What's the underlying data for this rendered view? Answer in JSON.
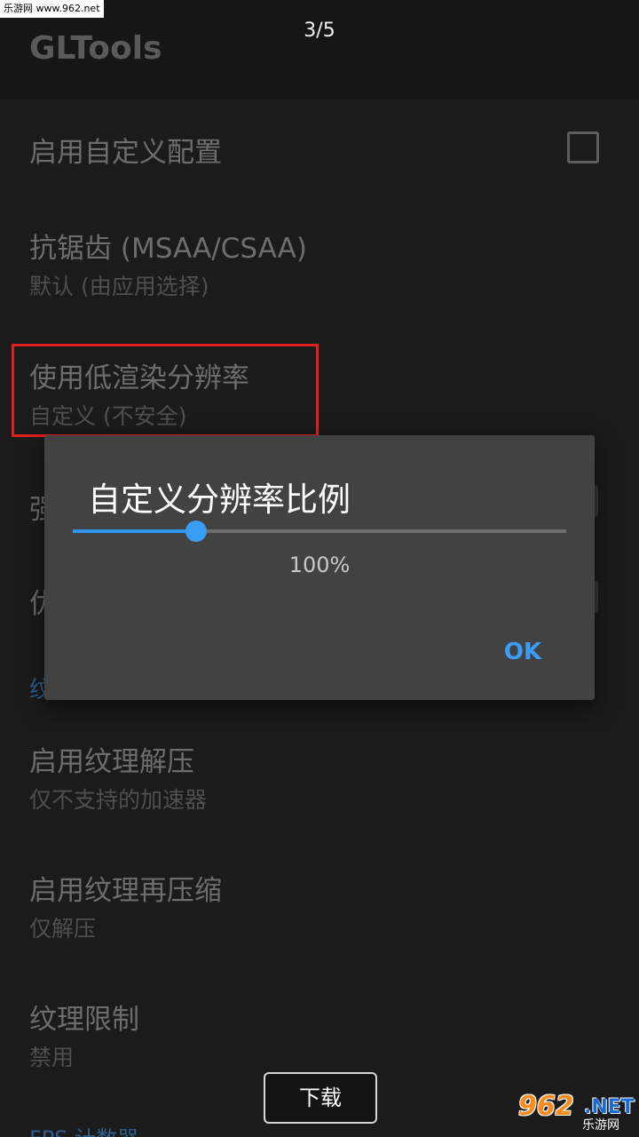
{
  "watermark": {
    "top_left": "乐游网 www.962.net",
    "bottom_right_num": "962",
    "bottom_right_net": ".NET",
    "bottom_right_cn": "乐游网"
  },
  "page_counter": "3/5",
  "app": {
    "title": "GLTools"
  },
  "settings": {
    "custom_config": {
      "title": "启用自定义配置",
      "checked": false
    },
    "antialiasing": {
      "title": "抗锯齿 (MSAA/CSAA)",
      "summary": "默认 (由应用选择)"
    },
    "low_res": {
      "title": "使用低渲染分辨率",
      "summary": "自定义 (不安全)"
    },
    "hidden_item_1_partial": "强",
    "hidden_item_2_partial": "优",
    "section_texture": "纹理选项",
    "texture_decompress": {
      "title": "启用纹理解压",
      "summary": "仅不支持的加速器"
    },
    "texture_recompress": {
      "title": "启用纹理再压缩",
      "summary": "仅解压"
    },
    "texture_limit": {
      "title": "纹理限制",
      "summary": "禁用"
    },
    "fps_counter_partial": "FPS 计数器"
  },
  "dialog": {
    "title": "自定义分辨率比例",
    "slider_fraction": 0.25,
    "value_text": "100%",
    "ok_label": "OK"
  },
  "download_button": "下载",
  "colors": {
    "accent": "#3a9df5",
    "highlight": "#e0201b",
    "dialog_bg": "#424242"
  }
}
